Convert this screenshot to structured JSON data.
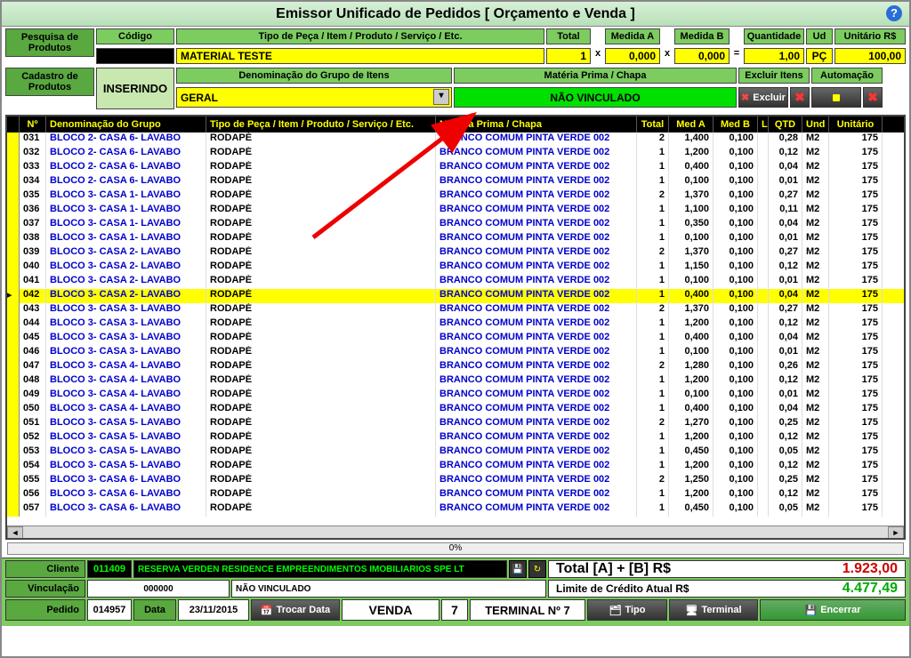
{
  "title": "Emissor Unificado de Pedidos [ Orçamento e Venda ]",
  "headers": {
    "pesquisa": "Pesquisa de Produtos",
    "cadastro": "Cadastro de Produtos",
    "codigo": "Código",
    "tipo_peca": "Tipo de Peça / Item / Produto / Serviço / Etc.",
    "total": "Total",
    "medA": "Medida A",
    "medB": "Medida B",
    "qtd": "Quantidade",
    "ud": "Ud",
    "unit": "Unitário R$",
    "denom_grupo": "Denominação do Grupo de Itens",
    "materia": "Matéria Prima / Chapa",
    "excluir_itens": "Excluir Itens",
    "automacao": "Automação"
  },
  "inputs": {
    "codigo_val": "",
    "inserindo": "INSERINDO",
    "material": "MATERIAL TESTE",
    "total": "1",
    "x1": "x",
    "medA": "0,000",
    "x2": "x",
    "medB": "0,000",
    "eq": "=",
    "qtd": "1,00",
    "ud": "PÇ",
    "unit": "100,00",
    "grupo": "GERAL",
    "vinculo": "NÃO VINCULADO",
    "btn_excluir": "Excluir"
  },
  "grid_headers": {
    "no": "Nº",
    "grp": "Denominação do Grupo",
    "tipo": "Tipo de Peça / Item / Produto / Serviço / Etc.",
    "mat": "Matéria Prima / Chapa",
    "tot": "Total",
    "ma": "Med A",
    "mb": "Med B",
    "l": "L",
    "qtd": "QTD",
    "und": "Und",
    "unit": "Unitário"
  },
  "rows": [
    {
      "no": "031",
      "grp": "BLOCO 2- CASA 6- LAVABO",
      "tipo": "RODAPÉ",
      "mat": "BRANCO COMUM PINTA VERDE 002",
      "tot": "2",
      "ma": "1,400",
      "mb": "0,100",
      "qtd": "0,28",
      "und": "M2",
      "unit": "175"
    },
    {
      "no": "032",
      "grp": "BLOCO 2- CASA 6- LAVABO",
      "tipo": "RODAPÉ",
      "mat": "BRANCO COMUM PINTA VERDE 002",
      "tot": "1",
      "ma": "1,200",
      "mb": "0,100",
      "qtd": "0,12",
      "und": "M2",
      "unit": "175"
    },
    {
      "no": "033",
      "grp": "BLOCO 2- CASA 6- LAVABO",
      "tipo": "RODAPÉ",
      "mat": "BRANCO COMUM PINTA VERDE 002",
      "tot": "1",
      "ma": "0,400",
      "mb": "0,100",
      "qtd": "0,04",
      "und": "M2",
      "unit": "175"
    },
    {
      "no": "034",
      "grp": "BLOCO 2- CASA 6- LAVABO",
      "tipo": "RODAPÉ",
      "mat": "BRANCO COMUM PINTA VERDE 002",
      "tot": "1",
      "ma": "0,100",
      "mb": "0,100",
      "qtd": "0,01",
      "und": "M2",
      "unit": "175"
    },
    {
      "no": "035",
      "grp": "BLOCO 3- CASA 1- LAVABO",
      "tipo": "RODAPÉ",
      "mat": "BRANCO COMUM PINTA VERDE 002",
      "tot": "2",
      "ma": "1,370",
      "mb": "0,100",
      "qtd": "0,27",
      "und": "M2",
      "unit": "175"
    },
    {
      "no": "036",
      "grp": "BLOCO 3- CASA 1- LAVABO",
      "tipo": "RODAPÉ",
      "mat": "BRANCO COMUM PINTA VERDE 002",
      "tot": "1",
      "ma": "1,100",
      "mb": "0,100",
      "qtd": "0,11",
      "und": "M2",
      "unit": "175"
    },
    {
      "no": "037",
      "grp": "BLOCO 3- CASA 1- LAVABO",
      "tipo": "RODAPÉ",
      "mat": "BRANCO COMUM PINTA VERDE 002",
      "tot": "1",
      "ma": "0,350",
      "mb": "0,100",
      "qtd": "0,04",
      "und": "M2",
      "unit": "175"
    },
    {
      "no": "038",
      "grp": "BLOCO 3- CASA 1- LAVABO",
      "tipo": "RODAPÉ",
      "mat": "BRANCO COMUM PINTA VERDE 002",
      "tot": "1",
      "ma": "0,100",
      "mb": "0,100",
      "qtd": "0,01",
      "und": "M2",
      "unit": "175"
    },
    {
      "no": "039",
      "grp": "BLOCO 3- CASA 2- LAVABO",
      "tipo": "RODAPÉ",
      "mat": "BRANCO COMUM PINTA VERDE 002",
      "tot": "2",
      "ma": "1,370",
      "mb": "0,100",
      "qtd": "0,27",
      "und": "M2",
      "unit": "175"
    },
    {
      "no": "040",
      "grp": "BLOCO 3- CASA 2- LAVABO",
      "tipo": "RODAPÉ",
      "mat": "BRANCO COMUM PINTA VERDE 002",
      "tot": "1",
      "ma": "1,150",
      "mb": "0,100",
      "qtd": "0,12",
      "und": "M2",
      "unit": "175"
    },
    {
      "no": "041",
      "grp": "BLOCO 3- CASA 2- LAVABO",
      "tipo": "RODAPÉ",
      "mat": "BRANCO COMUM PINTA VERDE 002",
      "tot": "1",
      "ma": "0,100",
      "mb": "0,100",
      "qtd": "0,01",
      "und": "M2",
      "unit": "175"
    },
    {
      "no": "042",
      "grp": "BLOCO 3- CASA 2- LAVABO",
      "tipo": "RODAPÉ",
      "mat": "BRANCO COMUM PINTA VERDE 002",
      "tot": "1",
      "ma": "0,400",
      "mb": "0,100",
      "qtd": "0,04",
      "und": "M2",
      "unit": "175",
      "sel": true
    },
    {
      "no": "043",
      "grp": "BLOCO 3- CASA 3- LAVABO",
      "tipo": "RODAPÉ",
      "mat": "BRANCO COMUM PINTA VERDE 002",
      "tot": "2",
      "ma": "1,370",
      "mb": "0,100",
      "qtd": "0,27",
      "und": "M2",
      "unit": "175"
    },
    {
      "no": "044",
      "grp": "BLOCO 3- CASA 3- LAVABO",
      "tipo": "RODAPÉ",
      "mat": "BRANCO COMUM PINTA VERDE 002",
      "tot": "1",
      "ma": "1,200",
      "mb": "0,100",
      "qtd": "0,12",
      "und": "M2",
      "unit": "175"
    },
    {
      "no": "045",
      "grp": "BLOCO 3- CASA 3- LAVABO",
      "tipo": "RODAPÉ",
      "mat": "BRANCO COMUM PINTA VERDE 002",
      "tot": "1",
      "ma": "0,400",
      "mb": "0,100",
      "qtd": "0,04",
      "und": "M2",
      "unit": "175"
    },
    {
      "no": "046",
      "grp": "BLOCO 3- CASA 3- LAVABO",
      "tipo": "RODAPÉ",
      "mat": "BRANCO COMUM PINTA VERDE 002",
      "tot": "1",
      "ma": "0,100",
      "mb": "0,100",
      "qtd": "0,01",
      "und": "M2",
      "unit": "175"
    },
    {
      "no": "047",
      "grp": "BLOCO 3- CASA 4- LAVABO",
      "tipo": "RODAPÉ",
      "mat": "BRANCO COMUM PINTA VERDE 002",
      "tot": "2",
      "ma": "1,280",
      "mb": "0,100",
      "qtd": "0,26",
      "und": "M2",
      "unit": "175"
    },
    {
      "no": "048",
      "grp": "BLOCO 3- CASA 4- LAVABO",
      "tipo": "RODAPÉ",
      "mat": "BRANCO COMUM PINTA VERDE 002",
      "tot": "1",
      "ma": "1,200",
      "mb": "0,100",
      "qtd": "0,12",
      "und": "M2",
      "unit": "175"
    },
    {
      "no": "049",
      "grp": "BLOCO 3- CASA 4- LAVABO",
      "tipo": "RODAPÉ",
      "mat": "BRANCO COMUM PINTA VERDE 002",
      "tot": "1",
      "ma": "0,100",
      "mb": "0,100",
      "qtd": "0,01",
      "und": "M2",
      "unit": "175"
    },
    {
      "no": "050",
      "grp": "BLOCO 3- CASA 4- LAVABO",
      "tipo": "RODAPÉ",
      "mat": "BRANCO COMUM PINTA VERDE 002",
      "tot": "1",
      "ma": "0,400",
      "mb": "0,100",
      "qtd": "0,04",
      "und": "M2",
      "unit": "175"
    },
    {
      "no": "051",
      "grp": "BLOCO 3- CASA 5- LAVABO",
      "tipo": "RODAPÉ",
      "mat": "BRANCO COMUM PINTA VERDE 002",
      "tot": "2",
      "ma": "1,270",
      "mb": "0,100",
      "qtd": "0,25",
      "und": "M2",
      "unit": "175"
    },
    {
      "no": "052",
      "grp": "BLOCO 3- CASA 5- LAVABO",
      "tipo": "RODAPÉ",
      "mat": "BRANCO COMUM PINTA VERDE 002",
      "tot": "1",
      "ma": "1,200",
      "mb": "0,100",
      "qtd": "0,12",
      "und": "M2",
      "unit": "175"
    },
    {
      "no": "053",
      "grp": "BLOCO 3- CASA 5- LAVABO",
      "tipo": "RODAPÉ",
      "mat": "BRANCO COMUM PINTA VERDE 002",
      "tot": "1",
      "ma": "0,450",
      "mb": "0,100",
      "qtd": "0,05",
      "und": "M2",
      "unit": "175"
    },
    {
      "no": "054",
      "grp": "BLOCO 3- CASA 5- LAVABO",
      "tipo": "RODAPÉ",
      "mat": "BRANCO COMUM PINTA VERDE 002",
      "tot": "1",
      "ma": "1,200",
      "mb": "0,100",
      "qtd": "0,12",
      "und": "M2",
      "unit": "175"
    },
    {
      "no": "055",
      "grp": "BLOCO 3- CASA 6- LAVABO",
      "tipo": "RODAPÉ",
      "mat": "BRANCO COMUM PINTA VERDE 002",
      "tot": "2",
      "ma": "1,250",
      "mb": "0,100",
      "qtd": "0,25",
      "und": "M2",
      "unit": "175"
    },
    {
      "no": "056",
      "grp": "BLOCO 3- CASA 6- LAVABO",
      "tipo": "RODAPÉ",
      "mat": "BRANCO COMUM PINTA VERDE 002",
      "tot": "1",
      "ma": "1,200",
      "mb": "0,100",
      "qtd": "0,12",
      "und": "M2",
      "unit": "175"
    },
    {
      "no": "057",
      "grp": "BLOCO 3- CASA 6- LAVABO",
      "tipo": "RODAPÉ",
      "mat": "BRANCO COMUM PINTA VERDE 002",
      "tot": "1",
      "ma": "0,450",
      "mb": "0,100",
      "qtd": "0,05",
      "und": "M2",
      "unit": "175"
    }
  ],
  "progress": "0%",
  "footer": {
    "cliente_lbl": "Cliente",
    "cliente_cod": "011409",
    "cliente_nome": "RESERVA VERDEN RESIDENCE EMPREENDIMENTOS IMOBILIARIOS SPE LT",
    "vinc_lbl": "Vinculação",
    "vinc_cod": "000000",
    "vinc_txt": "NÃO VINCULADO",
    "pedido_lbl": "Pedido",
    "pedido": "014957",
    "data_lbl": "Data",
    "data": "23/11/2015",
    "trocar": "Trocar Data",
    "venda": "VENDA",
    "terminal_no": "7",
    "terminal": "TERMINAL Nº 7",
    "tipo_btn": "Tipo",
    "terminal_btn": "Terminal",
    "encerrar": "Encerrar",
    "total_lbl": "Total [A] + [B] R$",
    "total_val": "1.923,00",
    "limite_lbl": "Limite de Crédito Atual R$",
    "limite_val": "4.477,49"
  }
}
